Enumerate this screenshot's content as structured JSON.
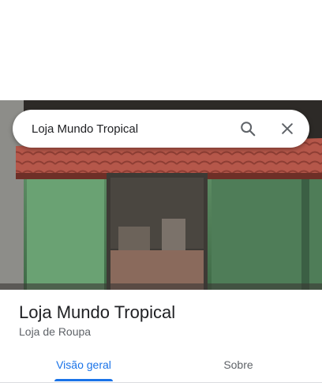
{
  "search": {
    "query": "Loja Mundo Tropical",
    "search_icon": "search-icon",
    "close_icon": "close-icon"
  },
  "place": {
    "name": "Loja Mundo Tropical",
    "category": "Loja de Roupa"
  },
  "tabs": [
    {
      "label": "Visão geral",
      "active": true
    },
    {
      "label": "Sobre",
      "active": false
    }
  ],
  "colors": {
    "accent": "#1a73e8",
    "text_primary": "#202124",
    "text_secondary": "#5f6368"
  }
}
